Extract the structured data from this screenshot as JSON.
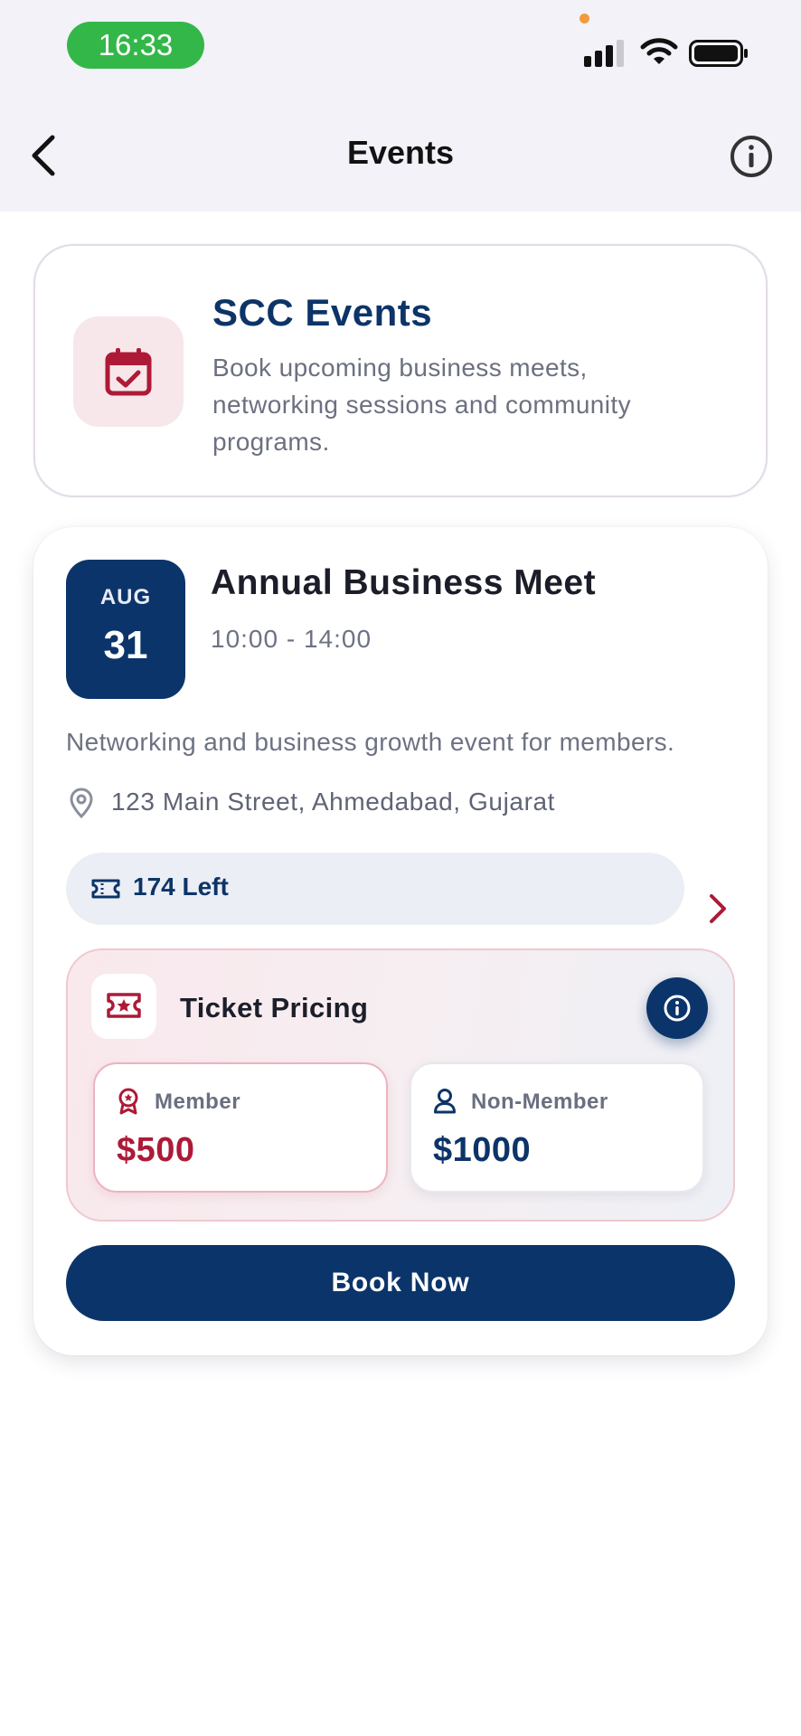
{
  "status_bar": {
    "time": "16:33"
  },
  "header": {
    "title": "Events",
    "back_icon": "chevron-left-icon",
    "info_icon": "info-icon"
  },
  "intro": {
    "title": "SCC Events",
    "description": "Book upcoming business meets, networking sessions and community programs.",
    "icon": "calendar-check-icon"
  },
  "event": {
    "month": "AUG",
    "day": "31",
    "title": "Annual Business Meet",
    "time": "10:00 - 14:00",
    "description": "Networking and business growth event for members.",
    "location": "123 Main Street, Ahmedabad, Gujarat",
    "seats_left": "174 Left",
    "pricing": {
      "title": "Ticket Pricing",
      "member_label": "Member",
      "member_price": "$500",
      "non_member_label": "Non-Member",
      "non_member_price": "$1000"
    },
    "book_label": "Book Now"
  },
  "colors": {
    "primary_navy": "#0b356a",
    "accent_red": "#ad1a37",
    "status_green": "#34b749"
  }
}
